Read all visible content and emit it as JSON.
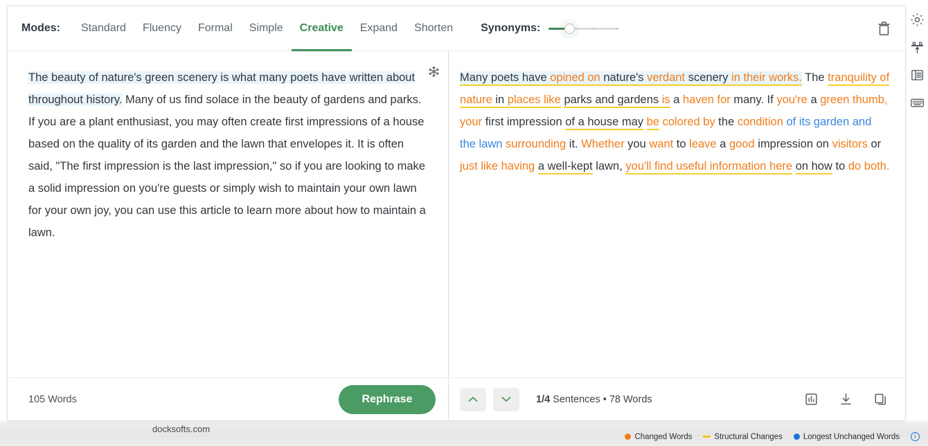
{
  "header": {
    "modes_label": "Modes:",
    "modes": [
      {
        "label": "Standard",
        "active": false
      },
      {
        "label": "Fluency",
        "active": false
      },
      {
        "label": "Formal",
        "active": false
      },
      {
        "label": "Simple",
        "active": false
      },
      {
        "label": "Creative",
        "active": true
      },
      {
        "label": "Expand",
        "active": false
      },
      {
        "label": "Shorten",
        "active": false
      }
    ],
    "synonyms_label": "Synonyms:",
    "synonyms_value": 28,
    "trash_icon": "trash-icon"
  },
  "left_pane": {
    "freeze_icon": "snowflake-icon",
    "text_segments": [
      {
        "text": "The beauty of nature's green scenery is what many poets have written about throughout history.",
        "style": "highlight"
      },
      {
        "text": " Many of us find solace in the beauty of gardens and parks. If you are a plant enthusiast, you may often create first impressions of a house based on the quality of its garden and the lawn that envelopes it. It is often said, \"The first impression is the last impression,\" so if you are looking to make a solid impression on you're guests or simply wish to maintain your own lawn for your own joy, you can use this article to learn more about how to maintain a lawn.",
        "style": "plain"
      }
    ],
    "word_count": "105 Words",
    "rephrase_label": "Rephrase"
  },
  "right_pane": {
    "text_segments": [
      {
        "text": "Many poets have ",
        "color": "plain",
        "highlight": true,
        "underline": true
      },
      {
        "text": "opined on",
        "color": "changed",
        "highlight": true,
        "underline": true
      },
      {
        "text": " nature's ",
        "color": "plain",
        "highlight": true,
        "underline": true
      },
      {
        "text": "verdant",
        "color": "changed",
        "highlight": true,
        "underline": true
      },
      {
        "text": " scenery ",
        "color": "plain",
        "highlight": true,
        "underline": true
      },
      {
        "text": "in their works.",
        "color": "changed",
        "highlight": true,
        "underline": true
      },
      {
        "text": " The ",
        "color": "plain",
        "highlight": false,
        "underline": false
      },
      {
        "text": "tranquility of nature",
        "color": "changed",
        "highlight": false,
        "underline": true
      },
      {
        "text": " in ",
        "color": "plain",
        "highlight": false,
        "underline": true
      },
      {
        "text": "places like",
        "color": "changed",
        "highlight": false,
        "underline": true
      },
      {
        "text": " ",
        "color": "plain",
        "highlight": false,
        "underline": false
      },
      {
        "text": "parks and gardens",
        "color": "plain",
        "highlight": false,
        "underline": true
      },
      {
        "text": " is",
        "color": "changed",
        "highlight": false,
        "underline": true
      },
      {
        "text": " a ",
        "color": "plain",
        "highlight": false,
        "underline": false
      },
      {
        "text": "haven for",
        "color": "changed",
        "highlight": false,
        "underline": false
      },
      {
        "text": " many. If ",
        "color": "plain",
        "highlight": false,
        "underline": false
      },
      {
        "text": "you're",
        "color": "changed",
        "highlight": false,
        "underline": false
      },
      {
        "text": " a ",
        "color": "plain",
        "highlight": false,
        "underline": false
      },
      {
        "text": "green thumb, your",
        "color": "changed",
        "highlight": false,
        "underline": false
      },
      {
        "text": " first impression ",
        "color": "plain",
        "highlight": false,
        "underline": false
      },
      {
        "text": "of a house may",
        "color": "plain",
        "highlight": false,
        "underline": true
      },
      {
        "text": " ",
        "color": "plain",
        "highlight": false,
        "underline": false
      },
      {
        "text": "be",
        "color": "changed",
        "highlight": false,
        "underline": true
      },
      {
        "text": " colored by",
        "color": "changed",
        "highlight": false,
        "underline": false
      },
      {
        "text": " the ",
        "color": "plain",
        "highlight": false,
        "underline": false
      },
      {
        "text": "condition",
        "color": "changed",
        "highlight": false,
        "underline": false
      },
      {
        "text": " of its garden and the lawn",
        "color": "unchanged",
        "highlight": false,
        "underline": false
      },
      {
        "text": " surrounding",
        "color": "changed",
        "highlight": false,
        "underline": false
      },
      {
        "text": " it. ",
        "color": "plain",
        "highlight": false,
        "underline": false
      },
      {
        "text": "Whether",
        "color": "changed",
        "highlight": false,
        "underline": false
      },
      {
        "text": " you ",
        "color": "plain",
        "highlight": false,
        "underline": false
      },
      {
        "text": "want",
        "color": "changed",
        "highlight": false,
        "underline": false
      },
      {
        "text": " to ",
        "color": "plain",
        "highlight": false,
        "underline": false
      },
      {
        "text": "leave",
        "color": "changed",
        "highlight": false,
        "underline": false
      },
      {
        "text": " a ",
        "color": "plain",
        "highlight": false,
        "underline": false
      },
      {
        "text": "good",
        "color": "changed",
        "highlight": false,
        "underline": false
      },
      {
        "text": " impression on ",
        "color": "plain",
        "highlight": false,
        "underline": false
      },
      {
        "text": "visitors",
        "color": "changed",
        "highlight": false,
        "underline": false
      },
      {
        "text": " or ",
        "color": "plain",
        "highlight": false,
        "underline": false
      },
      {
        "text": "just like having",
        "color": "changed",
        "highlight": false,
        "underline": false
      },
      {
        "text": " ",
        "color": "plain",
        "highlight": false,
        "underline": false
      },
      {
        "text": "a well-kept",
        "color": "plain",
        "highlight": false,
        "underline": true
      },
      {
        "text": " lawn, ",
        "color": "plain",
        "highlight": false,
        "underline": false
      },
      {
        "text": "you'll find useful information here",
        "color": "changed",
        "highlight": false,
        "underline": true
      },
      {
        "text": " ",
        "color": "plain",
        "highlight": false,
        "underline": false
      },
      {
        "text": "on how",
        "color": "plain",
        "highlight": false,
        "underline": true
      },
      {
        "text": " to ",
        "color": "plain",
        "highlight": false,
        "underline": false
      },
      {
        "text": "do both.",
        "color": "changed",
        "highlight": false,
        "underline": false
      }
    ],
    "prev_icon": "chevron-up-icon",
    "next_icon": "chevron-down-icon",
    "sentence_index": "1/4",
    "sentence_info": " Sentences • 78 Words",
    "icons": [
      "bar-chart-icon",
      "download-icon",
      "copy-icon"
    ]
  },
  "side_rail": {
    "icons": [
      "gear-icon",
      "upload-icon",
      "document-icon",
      "keyboard-icon"
    ]
  },
  "footer": {
    "watermark": "docksofts.com",
    "legend": [
      {
        "label": "Changed Words",
        "marker": "dot",
        "color": "#f07d1b"
      },
      {
        "label": "Structural Changes",
        "marker": "dash",
        "color": "#f5c518"
      },
      {
        "label": "Longest Unchanged Words",
        "marker": "dot",
        "color": "#1a73d4"
      }
    ],
    "info_icon": "info-icon",
    "info_glyph": "i"
  }
}
